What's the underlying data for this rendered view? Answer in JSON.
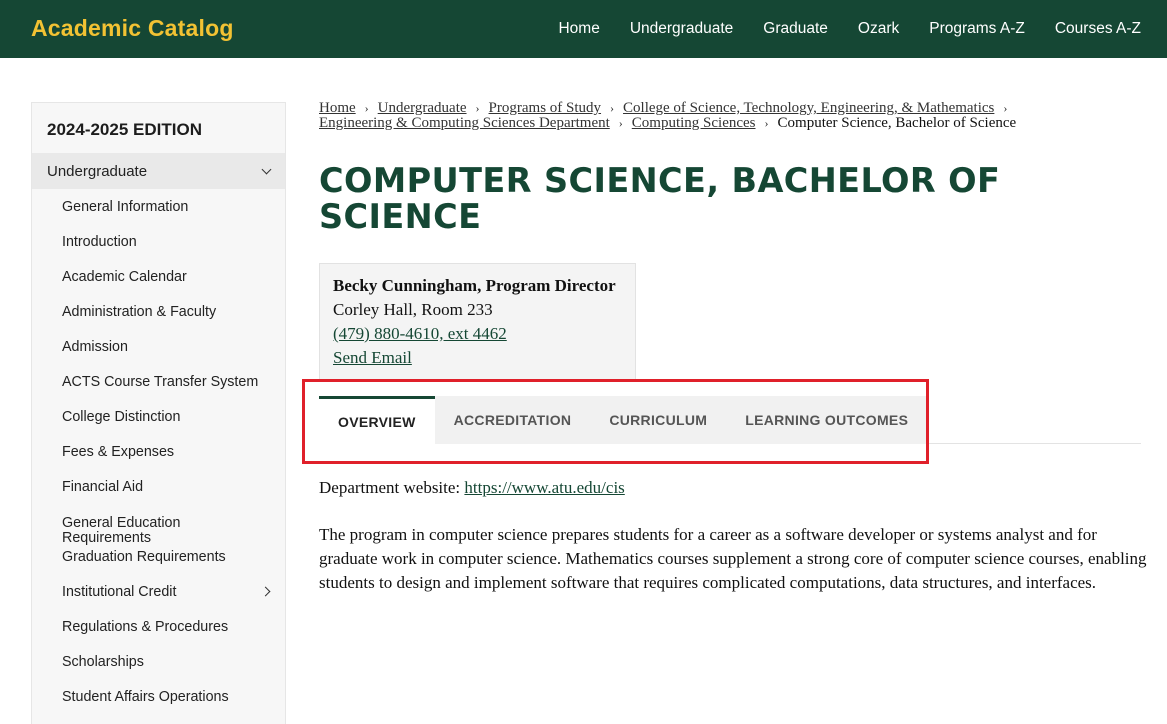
{
  "header": {
    "brand": "Academic Catalog",
    "nav": [
      "Home",
      "Undergraduate",
      "Graduate",
      "Ozark",
      "Programs A-Z",
      "Courses A-Z"
    ]
  },
  "sidebar": {
    "edition": "2024-2025 EDITION",
    "section": "Undergraduate",
    "items": [
      "General Information",
      "Introduction",
      "Academic Calendar",
      "Administration & Faculty",
      "Admission",
      "ACTS Course Transfer System",
      "College Distinction",
      "Fees & Expenses",
      "Financial Aid",
      "General Education Requirements",
      "Graduation Requirements",
      "Institutional Credit",
      "Regulations & Procedures",
      "Scholarships",
      "Student Affairs Operations"
    ]
  },
  "breadcrumb": {
    "links": [
      "Home",
      "Undergraduate",
      "Programs of Study",
      "College of Science, Technology, Engineering, & Mathematics",
      "Engineering & Computing Sciences Department",
      "Computing Sciences"
    ],
    "current": "Computer Science, Bachelor of Science"
  },
  "page": {
    "title": "COMPUTER SCIENCE, BACHELOR OF SCIENCE"
  },
  "contact": {
    "name": "Becky Cunningham, Program Director",
    "office": "Corley Hall, Room 233",
    "phone": "(479) 880-4610, ext 4462",
    "email_label": "Send Email"
  },
  "tabs": [
    "OVERVIEW",
    "ACCREDITATION",
    "CURRICULUM",
    "LEARNING OUTCOMES"
  ],
  "content": {
    "dept_label": "Department website: ",
    "dept_url": "https://www.atu.edu/cis",
    "description": "The program in computer science prepares students for a career as a software developer or systems analyst and for graduate work in computer science. Mathematics courses supplement a strong core of computer science courses, enabling students to design and implement software that requires complicated computations, data structures, and interfaces."
  },
  "colors": {
    "brand_green": "#154734",
    "brand_gold": "#f2c233",
    "highlight_red": "#e0202a"
  }
}
